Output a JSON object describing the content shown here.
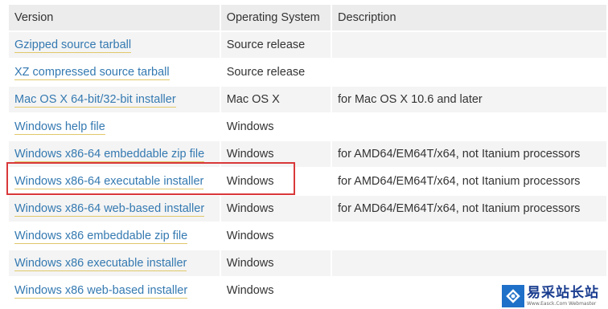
{
  "table": {
    "headers": {
      "version": "Version",
      "os": "Operating System",
      "description": "Description"
    },
    "rows": [
      {
        "version": "Gzipped source tarball",
        "os": "Source release",
        "description": ""
      },
      {
        "version": "XZ compressed source tarball",
        "os": "Source release",
        "description": ""
      },
      {
        "version": "Mac OS X 64-bit/32-bit installer",
        "os": "Mac OS X",
        "description": "for Mac OS X 10.6 and later"
      },
      {
        "version": "Windows help file",
        "os": "Windows",
        "description": ""
      },
      {
        "version": "Windows x86-64 embeddable zip file",
        "os": "Windows",
        "description": "for AMD64/EM64T/x64, not Itanium processors"
      },
      {
        "version": "Windows x86-64 executable installer",
        "os": "Windows",
        "description": "for AMD64/EM64T/x64, not Itanium processors"
      },
      {
        "version": "Windows x86-64 web-based installer",
        "os": "Windows",
        "description": "for AMD64/EM64T/x64, not Itanium processors"
      },
      {
        "version": "Windows x86 embeddable zip file",
        "os": "Windows",
        "description": ""
      },
      {
        "version": "Windows x86 executable installer",
        "os": "Windows",
        "description": ""
      },
      {
        "version": "Windows x86 web-based installer",
        "os": "Windows",
        "description": ""
      }
    ]
  },
  "highlight": {
    "row": "Windows x86-64 executable installer",
    "color": "#d9383a"
  },
  "colors": {
    "link": "#3479b1",
    "link_underline": "#e0c86a",
    "header_bg": "#ececec",
    "row_alt_bg": "#f4f4f4"
  },
  "watermark": {
    "title": "易采站长站",
    "subtitle": "Www.Easck.Com  Webmaster",
    "icon": "logo-icon"
  }
}
